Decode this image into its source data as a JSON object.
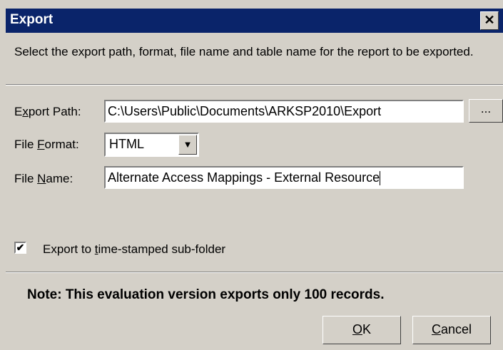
{
  "window": {
    "title": "Export",
    "close_glyph": "✕"
  },
  "description": "Select the export path, format, file name and table name for the report to be exported.",
  "export_path": {
    "label_pre": "E",
    "label_mnemonic": "x",
    "label_post": "port Path:",
    "value": "C:\\Users\\Public\\Documents\\ARKSP2010\\Export",
    "browse_label": "..."
  },
  "file_format": {
    "label_pre": "File ",
    "label_mnemonic": "F",
    "label_post": "ormat:",
    "selected": "HTML",
    "dropdown_glyph": "▼"
  },
  "file_name": {
    "label_pre": "File ",
    "label_mnemonic": "N",
    "label_post": "ame:",
    "value": "Alternate Access Mappings - External Resource"
  },
  "timestamp_option": {
    "checked": true,
    "check_glyph": "✔",
    "label_pre": "Export to ",
    "label_mnemonic": "t",
    "label_post": "ime-stamped sub-folder"
  },
  "note": "Note: This evaluation version exports only 100 records.",
  "buttons": {
    "ok": {
      "mnemonic": "O",
      "rest": "K"
    },
    "cancel": {
      "mnemonic": "C",
      "rest": "ancel"
    }
  }
}
